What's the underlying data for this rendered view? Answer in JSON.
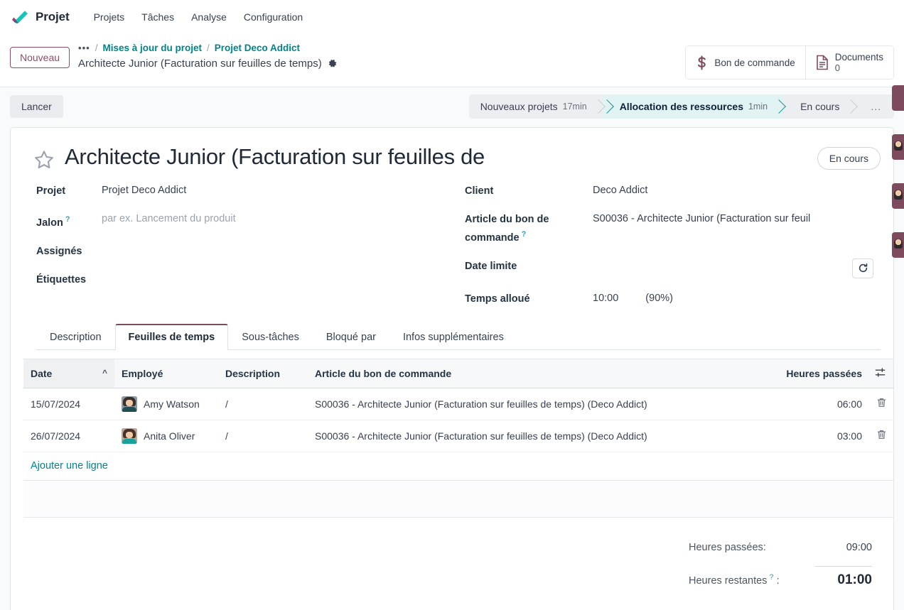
{
  "navbar": {
    "brand": "Projet",
    "logo_icon": "odoo-check-logo",
    "menu": [
      {
        "label": "Projets"
      },
      {
        "label": "Tâches"
      },
      {
        "label": "Analyse"
      },
      {
        "label": "Configuration"
      }
    ]
  },
  "control_panel": {
    "new_button": "Nouveau",
    "breadcrumb": {
      "overflow": "…",
      "separator": "/",
      "links": [
        {
          "label": "Mises à jour du projet"
        },
        {
          "label": "Projet Deco Addict"
        }
      ],
      "current": "Architecte Junior (Facturation sur feuilles de temps)",
      "settings_icon": "gear-icon"
    },
    "stat_buttons": [
      {
        "icon": "dollar-icon",
        "label": "Bon de commande",
        "value": ""
      },
      {
        "icon": "document-icon",
        "label": "Documents",
        "value": "0"
      }
    ]
  },
  "statusbar": {
    "action_button": "Lancer",
    "stages": [
      {
        "label": "Nouveaux projets",
        "time": "17min",
        "active": false
      },
      {
        "label": "Allocation des ressources",
        "time": "1min",
        "active": true
      },
      {
        "label": "En cours",
        "time": "",
        "active": false
      }
    ],
    "more": "..."
  },
  "record": {
    "star_icon": "star-icon",
    "title": "Architecte Junior (Facturation sur feuilles de",
    "state_badge": "En cours",
    "left_fields": [
      {
        "label": "Projet",
        "value": "Projet Deco Addict",
        "help": false,
        "placeholder": false
      },
      {
        "label": "Jalon",
        "value": "par ex. Lancement du produit",
        "help": true,
        "placeholder": true
      },
      {
        "label": "Assignés",
        "value": "",
        "help": false,
        "placeholder": false
      },
      {
        "label": "Étiquettes",
        "value": "",
        "help": false,
        "placeholder": false
      }
    ],
    "right_fields": {
      "client_label": "Client",
      "client_value": "Deco Addict",
      "sale_line_label": "Article du bon de commande",
      "sale_line_value": "S00036 - Architecte Junior (Facturation sur feuil",
      "deadline_label": "Date limite",
      "deadline_value": "",
      "refresh_icon": "refresh-icon",
      "allocated_label": "Temps alloué",
      "allocated_value": "10:00",
      "allocated_percent": "(90%)"
    }
  },
  "notebook": {
    "tabs": [
      {
        "label": "Description",
        "active": false
      },
      {
        "label": "Feuilles de temps",
        "active": true
      },
      {
        "label": "Sous-tâches",
        "active": false
      },
      {
        "label": "Bloqué par",
        "active": false
      },
      {
        "label": "Infos supplémentaires",
        "active": false
      }
    ]
  },
  "timesheets": {
    "columns": {
      "date": "Date",
      "employee": "Employé",
      "description": "Description",
      "sale_line": "Article du bon de commande",
      "hours": "Heures passées"
    },
    "sort_indicator": "^",
    "options_icon": "column-options-icon",
    "rows": [
      {
        "date": "15/07/2024",
        "employee": "Amy Watson",
        "avatar_icon": "employee-avatar",
        "avatar_hair": "#3a2f2b",
        "avatar_body": "#1f4f52",
        "description": "/",
        "sale_line": "S00036 - Architecte Junior (Facturation sur feuilles de temps) (Deco Addict)",
        "hours": "06:00",
        "delete_icon": "trash-icon"
      },
      {
        "date": "26/07/2024",
        "employee": "Anita Oliver",
        "avatar_icon": "employee-avatar",
        "avatar_hair": "#4a2f28",
        "avatar_body": "#17a39b",
        "description": "/",
        "sale_line": "S00036 - Architecte Junior (Facturation sur feuilles de temps) (Deco Addict)",
        "hours": "03:00",
        "delete_icon": "trash-icon"
      }
    ],
    "add_line": "Ajouter une ligne",
    "totals": {
      "spent_label": "Heures passées:",
      "spent_value": "09:00",
      "remaining_label": "Heures restantes",
      "remaining_suffix": ":",
      "remaining_value": "01:00"
    }
  },
  "colors": {
    "brand_teal": "#00848a",
    "accent_plum": "#7d4a5e",
    "active_stage_bg": "#e2f3f3"
  }
}
